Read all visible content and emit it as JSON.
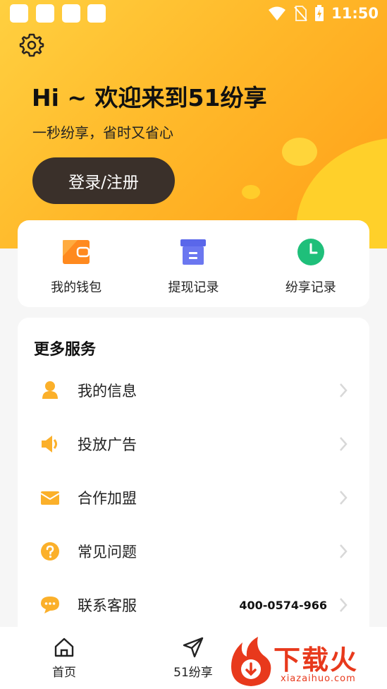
{
  "status_bar": {
    "time": "11:50"
  },
  "hero": {
    "title": "Hi ~ 欢迎来到51纷享",
    "subtitle": "一秒纷享，省时又省心",
    "login_label": "登录/注册"
  },
  "quick_actions": [
    {
      "label": "我的钱包",
      "icon": "wallet-icon",
      "color": "#ff8a1f"
    },
    {
      "label": "提现记录",
      "icon": "box-icon",
      "color": "#5a67ea"
    },
    {
      "label": "纷享记录",
      "icon": "clock-icon",
      "color": "#1fbf7a"
    }
  ],
  "services": {
    "title": "更多服务",
    "items": [
      {
        "label": "我的信息",
        "icon": "user-icon",
        "value": ""
      },
      {
        "label": "投放广告",
        "icon": "speaker-icon",
        "value": ""
      },
      {
        "label": "合作加盟",
        "icon": "mail-icon",
        "value": ""
      },
      {
        "label": "常见问题",
        "icon": "question-icon",
        "value": ""
      },
      {
        "label": "联系客服",
        "icon": "chat-icon",
        "value": "400-0574-966"
      }
    ]
  },
  "tabs": [
    {
      "label": "首页",
      "icon": "home-icon"
    },
    {
      "label": "51纷享",
      "icon": "send-icon"
    }
  ],
  "watermark": {
    "text": "下载火",
    "url": "xiazaihuo.com"
  },
  "colors": {
    "accent": "#ffb92a",
    "icon_orange": "#fbb02a",
    "dark_button": "#3a302a"
  }
}
